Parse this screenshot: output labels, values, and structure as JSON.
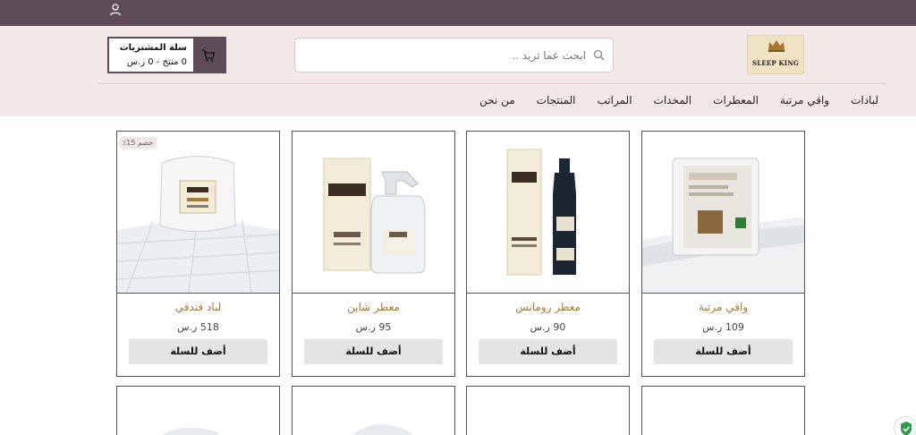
{
  "brand": {
    "name": "SLEEP KING"
  },
  "search": {
    "placeholder": "ابحث عما تريد .."
  },
  "cart": {
    "title": "سلة المشتريات",
    "summary": "0 منتج - 0 ر.س"
  },
  "nav": [
    "من نحن",
    "المنتجات",
    "المراتب",
    "المخدات",
    "المعطرات",
    "واقي مرتبة",
    "لبادات"
  ],
  "products": [
    {
      "name": "واقي مرتبة",
      "price": "109 ر.س",
      "button": "أضف للسلة",
      "image": "mattress-protector",
      "badge": ""
    },
    {
      "name": "معطر رومانس",
      "price": "90 ر.س",
      "button": "أضف للسلة",
      "image": "romance-perfume-bottle",
      "badge": ""
    },
    {
      "name": "معطر شاين",
      "price": "95 ر.س",
      "button": "أضف للسلة",
      "image": "shine-spray-bottle",
      "badge": ""
    },
    {
      "name": "لباد فندقي",
      "price": "518 ر.س",
      "button": "أضف للسلة",
      "image": "hotel-topper",
      "badge": "خصم 15٪"
    }
  ],
  "colors": {
    "topbar": "#5d4b58",
    "header_bg": "#f3e8e8",
    "product_name": "#a47a3a",
    "add_button": "#e4e4e4"
  }
}
